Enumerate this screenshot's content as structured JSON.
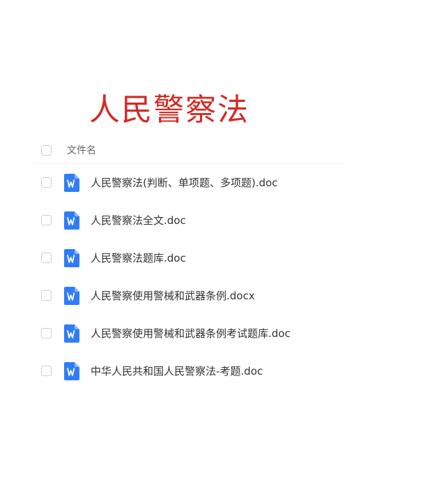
{
  "title": "人民警察法",
  "list": {
    "header_label": "文件名"
  },
  "files": [
    {
      "name": "人民警察法(判断、单项题、多项题).doc",
      "icon": "word-doc-icon"
    },
    {
      "name": "人民警察法全文.doc",
      "icon": "word-doc-icon"
    },
    {
      "name": "人民警察法题库.doc",
      "icon": "word-doc-icon"
    },
    {
      "name": "人民警察使用警械和武器条例.docx",
      "icon": "word-doc-icon"
    },
    {
      "name": "人民警察使用警械和武器条例考试题库.doc",
      "icon": "word-doc-icon"
    },
    {
      "name": "中华人民共和国人民警察法-考题.doc",
      "icon": "word-doc-icon"
    }
  ],
  "colors": {
    "title": "#d42a22",
    "word_icon": "#2f7df6"
  }
}
